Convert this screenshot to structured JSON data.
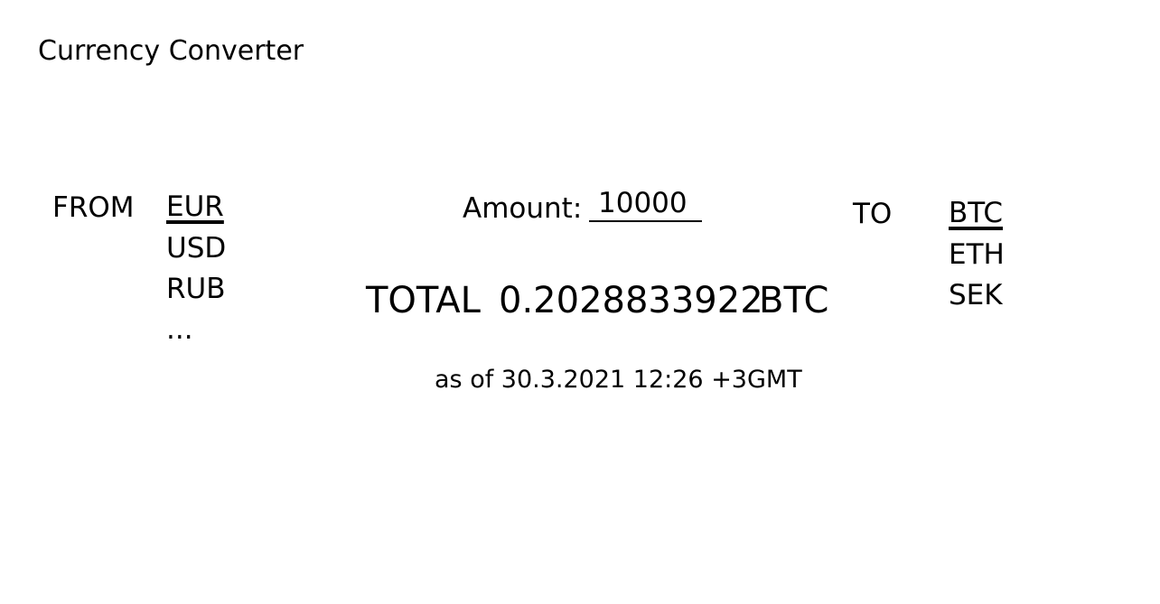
{
  "app": {
    "title": "Currency Converter"
  },
  "from": {
    "label": "FROM",
    "currencies": [
      {
        "code": "EUR",
        "selected": true
      },
      {
        "code": "USD",
        "selected": false
      },
      {
        "code": "RUB",
        "selected": false
      },
      {
        "code": "...",
        "selected": false
      }
    ]
  },
  "to": {
    "label": "TO",
    "currencies": [
      {
        "code": "BTC",
        "selected": true
      },
      {
        "code": "ETH",
        "selected": false
      },
      {
        "code": "SEK",
        "selected": false
      }
    ]
  },
  "amount": {
    "label": "Amount:",
    "value": "10000"
  },
  "result": {
    "label": "TOTAL",
    "value": "0.2028833922",
    "currency": "BTC",
    "timestamp": "as of 30.3.2021 12:26 +3GMT"
  }
}
